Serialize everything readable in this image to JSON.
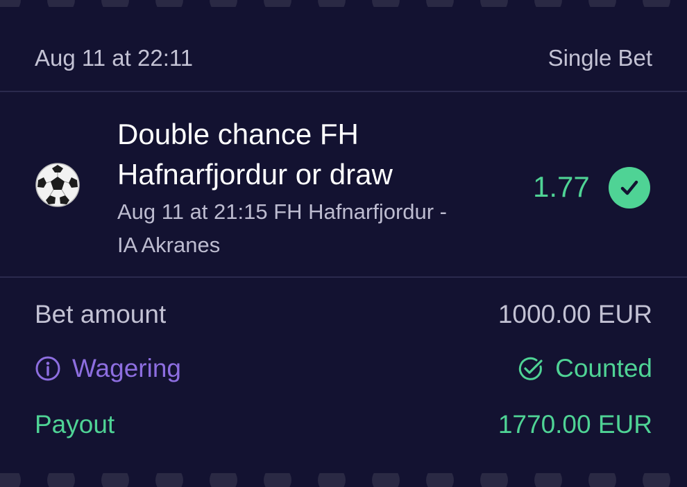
{
  "header": {
    "placed_at": "Aug 11 at 22:11",
    "bet_type": "Single Bet"
  },
  "selection": {
    "sport_icon": "soccer-ball-icon",
    "market_line1": "Double chance FH",
    "market_line2": "Hafnarfjordur or draw",
    "event_line1": "Aug 11 at 21:15 FH Hafnarfjordur -",
    "event_line2": "IA Akranes",
    "odds": "1.77",
    "status_icon": "check-circle-icon"
  },
  "details": {
    "bet_amount_label": "Bet amount",
    "bet_amount_value": "1000.00 EUR",
    "wagering_label": "Wagering",
    "wagering_icon": "info-icon",
    "wagering_value": "Counted",
    "wagering_value_icon": "check-circle-outline-icon",
    "payout_label": "Payout",
    "payout_value": "1770.00 EUR"
  },
  "colors": {
    "background": "#131231",
    "divider": "#2b2a4d",
    "muted_text": "#c3c2d4",
    "win_green": "#4fd395",
    "wagering_purple": "#8d6ee0"
  }
}
